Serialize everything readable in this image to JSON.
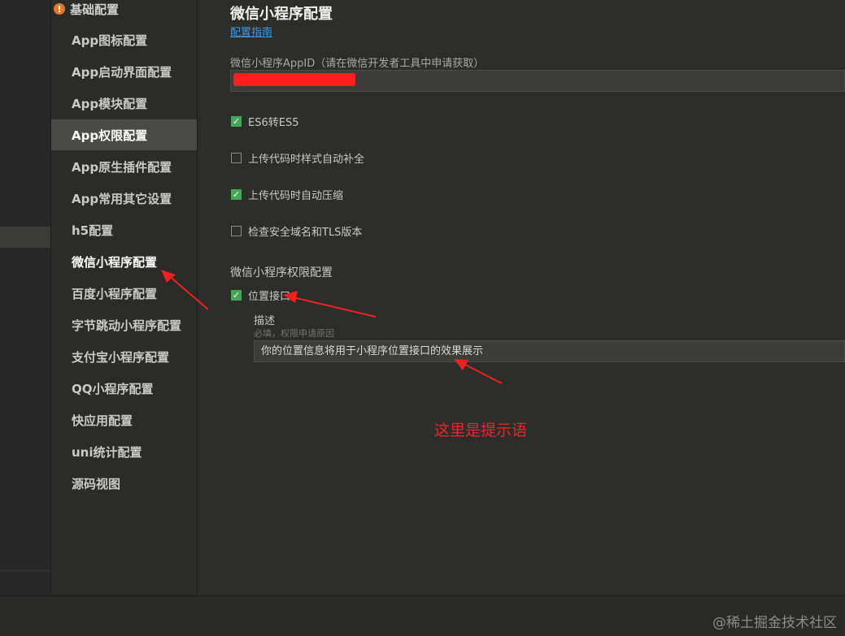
{
  "sidebar": {
    "top_item": "基础配置",
    "items": [
      {
        "label": "App图标配置"
      },
      {
        "label": "App启动界面配置"
      },
      {
        "label": "App模块配置"
      },
      {
        "label": "App权限配置"
      },
      {
        "label": "App原生插件配置"
      },
      {
        "label": "App常用其它设置"
      },
      {
        "label": "h5配置"
      },
      {
        "label": "微信小程序配置"
      },
      {
        "label": "百度小程序配置"
      },
      {
        "label": "字节跳动小程序配置"
      },
      {
        "label": "支付宝小程序配置"
      },
      {
        "label": "QQ小程序配置"
      },
      {
        "label": "快应用配置"
      },
      {
        "label": "uni统计配置"
      },
      {
        "label": "源码视图"
      }
    ]
  },
  "main": {
    "title": "微信小程序配置",
    "guide_link": "配置指南",
    "appid_label": "微信小程序AppID（请在微信开发者工具中申请获取）",
    "checkboxes": [
      {
        "label": "ES6转ES5",
        "checked": true
      },
      {
        "label": "上传代码时样式自动补全",
        "checked": false
      },
      {
        "label": "上传代码时自动压缩",
        "checked": true
      },
      {
        "label": "检查安全域名和TLS版本",
        "checked": false
      }
    ],
    "permission_section_title": "微信小程序权限配置",
    "permission": {
      "label": "位置接口",
      "checked": true,
      "desc_label": "描述",
      "desc_hint": "必填，权限申请原因",
      "desc_value": "你的位置信息将用于小程序位置接口的效果展示"
    }
  },
  "annotation_text": "这里是提示语",
  "watermark": "@稀土掘金技术社区",
  "colors": {
    "accent_link": "#3e9be6",
    "checkbox_on": "#45a65a",
    "annotation": "#e8262a",
    "warning": "#e5782a"
  }
}
